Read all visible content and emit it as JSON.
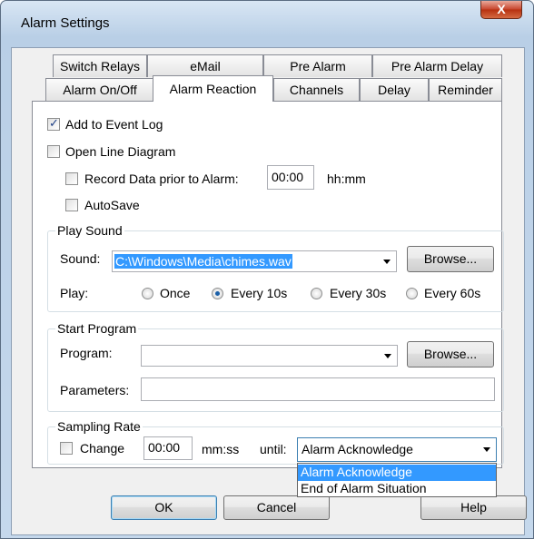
{
  "window": {
    "title": "Alarm Settings",
    "close_label": "X"
  },
  "tabs": {
    "row_back": [
      "Switch Relays",
      "eMail",
      "Pre Alarm",
      "Pre Alarm Delay"
    ],
    "row_front": [
      "Alarm On/Off",
      "Alarm Reaction",
      "Channels",
      "Delay",
      "Reminder"
    ],
    "active": "Alarm Reaction"
  },
  "options": {
    "add_to_event_log": "Add to Event Log",
    "open_line_diagram": "Open Line Diagram",
    "record_data_prior": "Record Data prior to Alarm:",
    "record_time_value": "00:00",
    "record_time_unit": "hh:mm",
    "autosave": "AutoSave"
  },
  "play_sound": {
    "title": "Play Sound",
    "sound_label": "Sound:",
    "sound_value": "C:\\Windows\\Media\\chimes.wav",
    "browse_label": "Browse...",
    "play_label": "Play:",
    "play_options": [
      "Once",
      "Every 10s",
      "Every 30s",
      "Every 60s"
    ],
    "play_selected": "Every 10s"
  },
  "start_program": {
    "title": "Start Program",
    "program_label": "Program:",
    "program_value": "",
    "browse_label": "Browse...",
    "parameters_label": "Parameters:",
    "parameters_value": ""
  },
  "sampling_rate": {
    "title": "Sampling Rate",
    "change_label": "Change",
    "time_value": "00:00",
    "time_unit": "mm:ss",
    "until_label": "until:",
    "until_value": "Alarm Acknowledge",
    "until_options": [
      "Alarm Acknowledge",
      "End of Alarm Situation"
    ]
  },
  "footer": {
    "ok": "OK",
    "cancel": "Cancel",
    "help": "Help"
  }
}
